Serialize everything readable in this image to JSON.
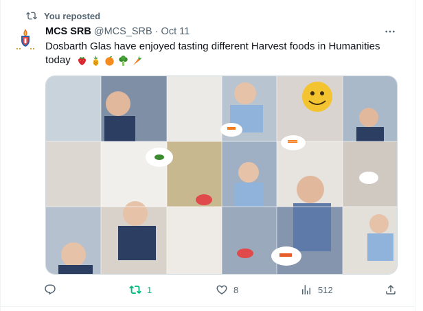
{
  "repost_banner": {
    "text": "You reposted",
    "icon": "repost-icon"
  },
  "author": {
    "name": "MCS SRB",
    "handle": "@MCS_SRB",
    "separator": "·",
    "date": "Oct 11",
    "avatar_icon": "school-logo-icon"
  },
  "tweet": {
    "text": "Dosbarth Glas have enjoyed tasting different Harvest foods in Humanities today",
    "emojis": [
      "strawberry-emoji",
      "pineapple-emoji",
      "orange-emoji",
      "broccoli-emoji",
      "carrot-emoji"
    ]
  },
  "media": {
    "description_icon": "photo-collage"
  },
  "actions": {
    "reply": {
      "icon": "reply-icon",
      "count": ""
    },
    "repost": {
      "icon": "repost-icon",
      "count": "1",
      "active_color": "#00ba7c"
    },
    "like": {
      "icon": "heart-icon",
      "count": "8"
    },
    "views": {
      "icon": "views-icon",
      "count": "512"
    },
    "share": {
      "icon": "share-icon",
      "count": ""
    }
  },
  "colors": {
    "text": "#0f1419",
    "secondary": "#536471",
    "repost_green": "#00ba7c",
    "border": "#cfd9de"
  }
}
